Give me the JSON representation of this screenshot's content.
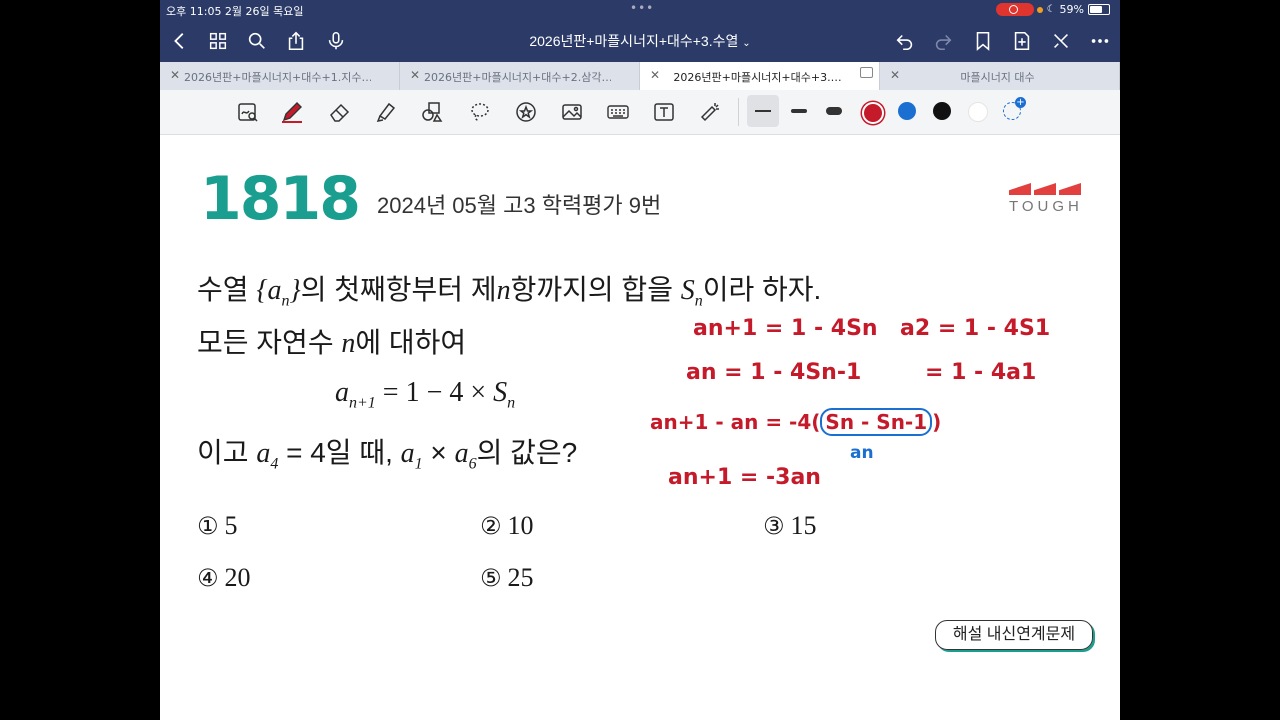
{
  "status": {
    "time_date": "오후 11:05   2월 26일 목요일",
    "battery": "59%"
  },
  "nav": {
    "title": "2026년판+마플시너지+대수+3.수열"
  },
  "tabs": [
    {
      "label": "2026년판+마플시너지+대수+1.지수…"
    },
    {
      "label": "2026년판+마플시너지+대수+2.삼각…"
    },
    {
      "label": "2026년판+마플시너지+대수+3.…"
    },
    {
      "label": "마플시너지 대수"
    }
  ],
  "toolbar": {
    "colors": [
      "#c41a2a",
      "#1a6fd1",
      "#111111",
      "#ffffff"
    ]
  },
  "problem": {
    "number": "1818",
    "source": "2024년 05월 고3 학력평가 9번",
    "brand": "TOUGH",
    "line1_a": "수열 ",
    "set_open": "{",
    "seq": "a",
    "sub_n": "n",
    "set_close": "}",
    "line1_b": "의 첫째항부터 제",
    "var_n": "n",
    "line1_c": "항까지의 합을 ",
    "sum": "S",
    "line1_d": "이라 하자.",
    "line2_a": "모든 자연수 ",
    "line2_b": "에 대하여",
    "eq_a": "a",
    "eq_sub": "n+1",
    "eq_mid": " = 1 − 4 × ",
    "eq_s": "S",
    "eq_ssub": "n",
    "line4_a": "이고 ",
    "a4": "a",
    "a4_sub": "4",
    "line4_b": " = 4일 때, ",
    "a1": "a",
    "a1_sub": "1",
    "times": " × ",
    "a6": "a",
    "a6_sub": "6",
    "line4_c": "의 값은?",
    "choices": [
      {
        "mark": "①",
        "val": "5"
      },
      {
        "mark": "②",
        "val": "10"
      },
      {
        "mark": "③",
        "val": "15"
      },
      {
        "mark": "④",
        "val": "20"
      },
      {
        "mark": "⑤",
        "val": "25"
      }
    ],
    "solution_button": "해설 내신연계문제"
  },
  "handwriting": {
    "l1": "an+1 = 1 - 4Sn",
    "l2": "an = 1 - 4Sn-1",
    "l3a": "an+1 - an = -4(",
    "l3b": "Sn - Sn-1",
    "l3c": ")",
    "l3note": "an",
    "l4": "an+1 = -3an",
    "r1": "a2 = 1 - 4S1",
    "r2": "= 1 - 4a1"
  }
}
